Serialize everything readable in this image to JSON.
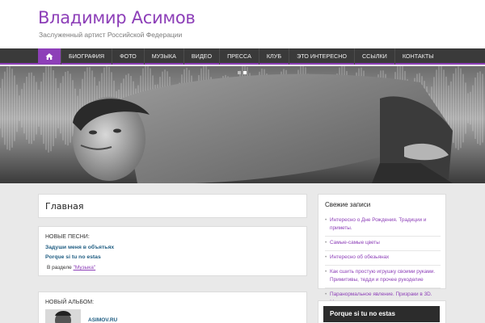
{
  "header": {
    "site_title": "Владимир Асимов",
    "site_description": "Заслуженный артист Российской Федерации"
  },
  "nav": {
    "home_icon": "home-icon",
    "items": [
      "БИОГРАФИЯ",
      "ФОТО",
      "МУЗЫКА",
      "ВИДЕО",
      "ПРЕССА",
      "КЛУБ",
      "ЭТО ИНТЕРЕСНО",
      "ССЫЛКИ",
      "КОНТАКТЫ"
    ]
  },
  "hero": {
    "active_slide": 2,
    "slide_count": 2
  },
  "main": {
    "page_title": "Главная",
    "new_songs": {
      "heading": "НОВЫЕ ПЕСНИ:",
      "songs": [
        "Задуши меня в объятьях",
        "Porque si tu no estas"
      ],
      "section_prefix": "В разделе",
      "section_link": "\"Музыка\""
    },
    "new_album": {
      "heading": "НОВЫЙ АЛЬБОМ:",
      "site_label": "ASIMOV.RU"
    }
  },
  "sidebar": {
    "recent_title": "Свежие записи",
    "recent_posts": [
      "Интересно о Дне Рождения. Традиции и приметы.",
      "Самые-самые цветы",
      "Интересно об обезьянах",
      "Как сшить простую игрушку своими руками. Примитивы, тедди и прочее рукоделие",
      "Паранормальное явление. Призраки в 3D. Мистическая премьера."
    ],
    "video_title": "Porque si tu no estas"
  },
  "colors": {
    "accent": "#8d3fb8",
    "nav_bg": "#3a3a3a",
    "page_bg": "#e9e9e9"
  }
}
